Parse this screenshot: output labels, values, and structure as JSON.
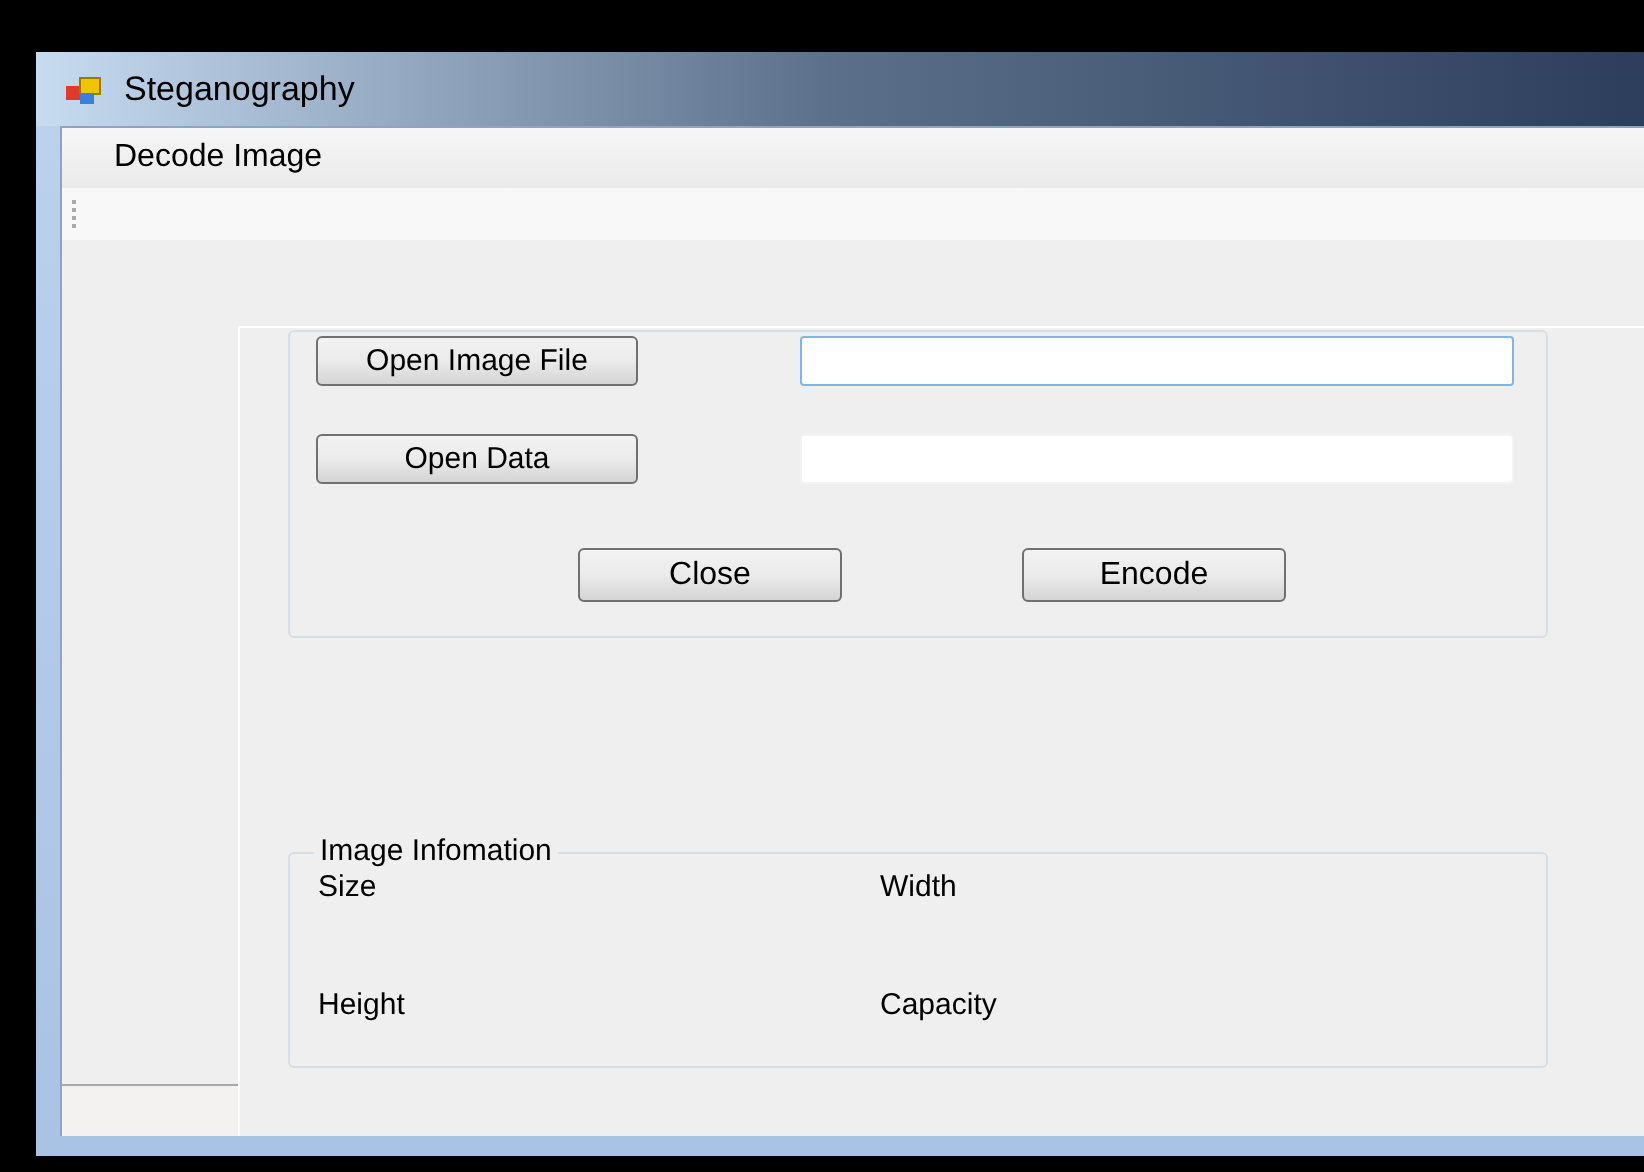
{
  "window": {
    "title": "Steganography"
  },
  "menu": [
    {
      "label": "Decode Image"
    }
  ],
  "file_rows": [
    {
      "button": "Open Image File",
      "focused": true
    },
    {
      "button": "Open Data",
      "focused": false
    }
  ],
  "actions": [
    "Close",
    "Encode"
  ],
  "image_info": {
    "legend": "Image Infomation",
    "fields": [
      "Size",
      "Width",
      "Height",
      "Capacity"
    ]
  }
}
